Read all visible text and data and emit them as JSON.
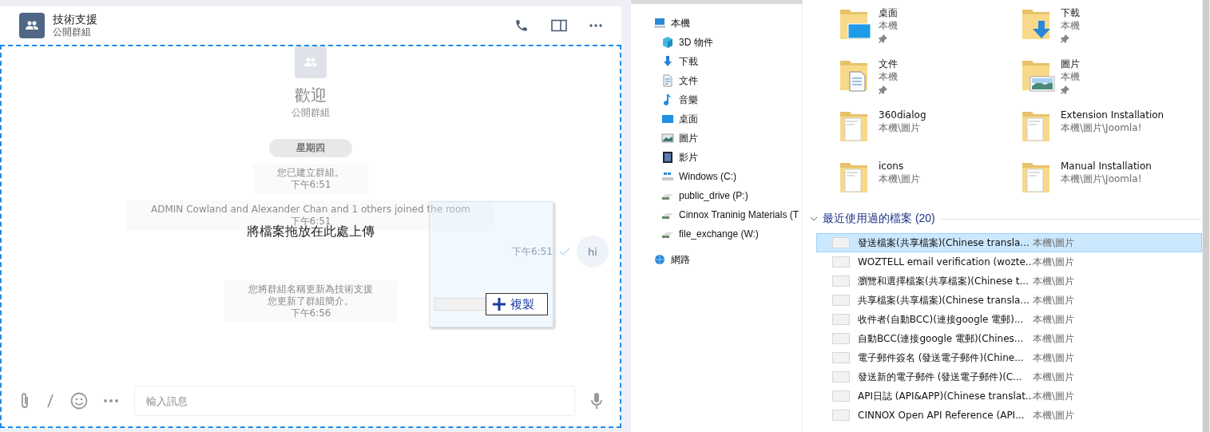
{
  "chat": {
    "title": "技術支援",
    "subtitle": "公開群組",
    "welcome": {
      "title": "歡迎",
      "subtitle": "公開群組"
    },
    "day_label": "星期四",
    "messages": [
      {
        "kind": "system",
        "lines": [
          "您已建立群組。"
        ],
        "time": "下午6:51"
      },
      {
        "kind": "system",
        "lines": [
          "ADMIN Cowland and Alexander Chan and 1 others joined the room"
        ],
        "time": "下午6:51"
      },
      {
        "kind": "outgoing",
        "text": "hi",
        "time": "下午6:51",
        "read": true
      },
      {
        "kind": "system",
        "lines": [
          "您將群組名稱更新為技術支援",
          "您更新了群組簡介。"
        ],
        "time": "下午6:56"
      }
    ],
    "drop_hint": "將檔案拖放在此處上傳",
    "drag_label": "複製",
    "input": {
      "placeholder": "輸入訊息"
    }
  },
  "explorer": {
    "nav": [
      {
        "label": "本機",
        "kind": "pc",
        "children": [
          {
            "label": "3D 物件",
            "kind": "cube"
          },
          {
            "label": "下載",
            "kind": "download"
          },
          {
            "label": "文件",
            "kind": "doc"
          },
          {
            "label": "音樂",
            "kind": "music"
          },
          {
            "label": "桌面",
            "kind": "desktop"
          },
          {
            "label": "圖片",
            "kind": "picture"
          },
          {
            "label": "影片",
            "kind": "video"
          },
          {
            "label": "Windows (C:)",
            "kind": "windrive"
          },
          {
            "label": "public_drive (P:)",
            "kind": "netdrive"
          },
          {
            "label": "Cinnox Traninig Materials (T",
            "kind": "netdrive"
          },
          {
            "label": "file_exchange (W:)",
            "kind": "netdrive"
          }
        ]
      },
      {
        "label": "網路",
        "kind": "network"
      }
    ],
    "quick_access": [
      {
        "name": "桌面",
        "location": "本機",
        "pinned": true,
        "kind": "desktop"
      },
      {
        "name": "下載",
        "location": "本機",
        "pinned": true,
        "kind": "download"
      },
      {
        "name": "文件",
        "location": "本機",
        "pinned": true,
        "kind": "doc"
      },
      {
        "name": "圖片",
        "location": "本機",
        "pinned": true,
        "kind": "picture"
      },
      {
        "name": "360dialog",
        "location": "本機\\圖片",
        "pinned": false,
        "kind": "content"
      },
      {
        "name": "Extension Installation",
        "location": "本機\\圖片\\Joomla!",
        "pinned": false,
        "kind": "content"
      },
      {
        "name": "icons",
        "location": "本機\\圖片",
        "pinned": false,
        "kind": "content"
      },
      {
        "name": "Manual Installation",
        "location": "本機\\圖片\\Joomla!",
        "pinned": false,
        "kind": "content"
      }
    ],
    "recent": {
      "title": "最近使用過的檔案 (20)",
      "expanded": true,
      "files": [
        {
          "name": "發送檔案(共享檔案)(Chinese transla...",
          "location": "本機\\圖片",
          "selected": true
        },
        {
          "name": "WOZTELL email verification (wozte...",
          "location": "本機\\圖片",
          "selected": false
        },
        {
          "name": "瀏覽和選擇檔案(共享檔案)(Chinese t...",
          "location": "本機\\圖片",
          "selected": false
        },
        {
          "name": "共享檔案(共享檔案)(Chinese transla...",
          "location": "本機\\圖片",
          "selected": false
        },
        {
          "name": "收件者(自動BCC)(連接google 電郵)...",
          "location": "本機\\圖片",
          "selected": false
        },
        {
          "name": "自動BCC(連接google 電郵)(Chines...",
          "location": "本機\\圖片",
          "selected": false
        },
        {
          "name": "電子郵件簽名 (發送電子郵件)(Chine...",
          "location": "本機\\圖片",
          "selected": false
        },
        {
          "name": "發送新的電子郵件 (發送電子郵件)(C...",
          "location": "本機\\圖片",
          "selected": false
        },
        {
          "name": "API日誌 (API&APP)(Chinese translat...",
          "location": "本機\\圖片",
          "selected": false
        },
        {
          "name": "CINNOX Open API Reference (API...",
          "location": "本機\\圖片",
          "selected": false
        }
      ]
    }
  }
}
